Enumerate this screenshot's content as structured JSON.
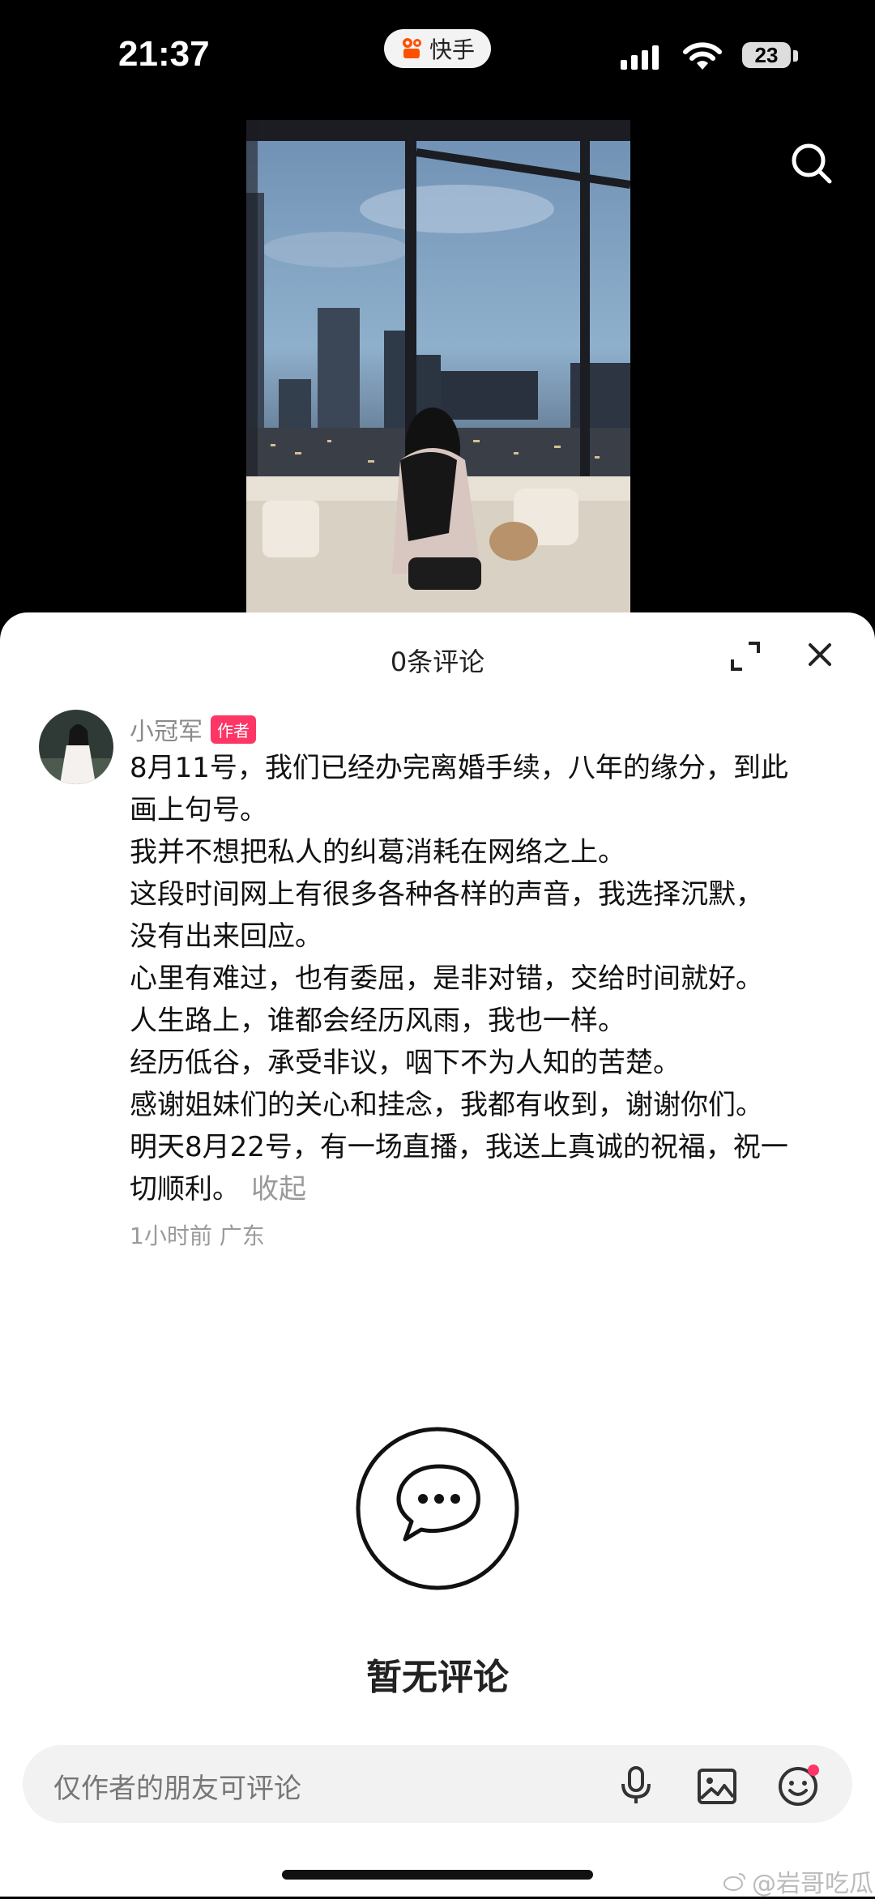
{
  "status_bar": {
    "time": "21:37",
    "app_name": "快手",
    "battery": "23"
  },
  "sheet": {
    "title": "0条评论"
  },
  "comment": {
    "author": "小冠军",
    "badge": "作者",
    "lines": [
      "8月11号，我们已经办完离婚手续，八年的缘分，到此",
      "画上句号。",
      "我并不想把私人的纠葛消耗在网络之上。",
      "这段时间网上有很多各种各样的声音，我选择沉默，",
      "没有出来回应。",
      "心里有难过，也有委屈，是非对错，交给时间就好。",
      "人生路上，谁都会经历风雨，我也一样。",
      "经历低谷，承受非议，咽下不为人知的苦楚。",
      "感谢姐妹们的关心和挂念，我都有收到，谢谢你们。",
      "明天8月22号，有一场直播，我送上真诚的祝福，祝一",
      "切顺利。"
    ],
    "collapse_label": "收起",
    "meta": "1小时前 广东"
  },
  "empty_state": {
    "text": "暂无评论"
  },
  "input": {
    "placeholder": "仅作者的朋友可评论"
  },
  "watermark": "@岩哥吃瓜",
  "colors": {
    "badge": "#fe3666",
    "notification_dot": "#fe3666"
  }
}
